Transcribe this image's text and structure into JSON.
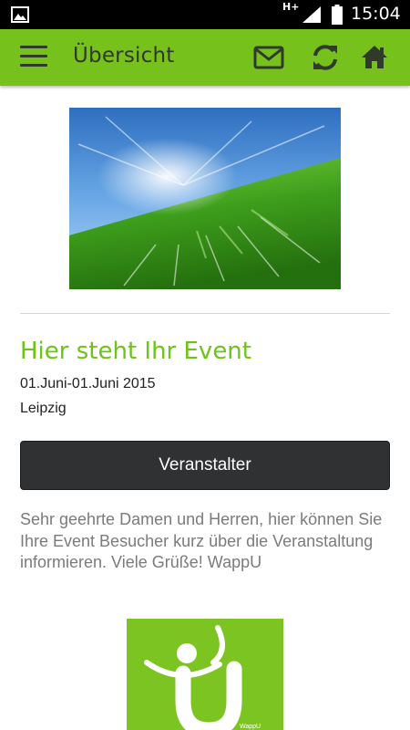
{
  "status_bar": {
    "network_type": "H+",
    "time": "15:04",
    "icons": [
      "gallery-icon",
      "signal-icon",
      "battery-icon"
    ]
  },
  "app_bar": {
    "title": "Übersicht",
    "icons": [
      "menu-icon",
      "mail-icon",
      "refresh-icon",
      "home-icon"
    ],
    "color": "#77c11d"
  },
  "event": {
    "title": "Hier steht Ihr Event",
    "date": "01.Juni-01.Juni 2015",
    "location": "Leipzig",
    "organizer_button_label": "Veranstalter",
    "description": "Sehr geehrte Damen und Herren,   hier können Sie Ihre Event Besucher kurz über die Veranstaltung informieren.  Viele Grüße! WappU"
  },
  "logo": {
    "small_text": "WappU"
  },
  "colors": {
    "accent_green": "#6cc417",
    "button_dark": "#2f3132",
    "body_text": "#7b7b7b"
  }
}
